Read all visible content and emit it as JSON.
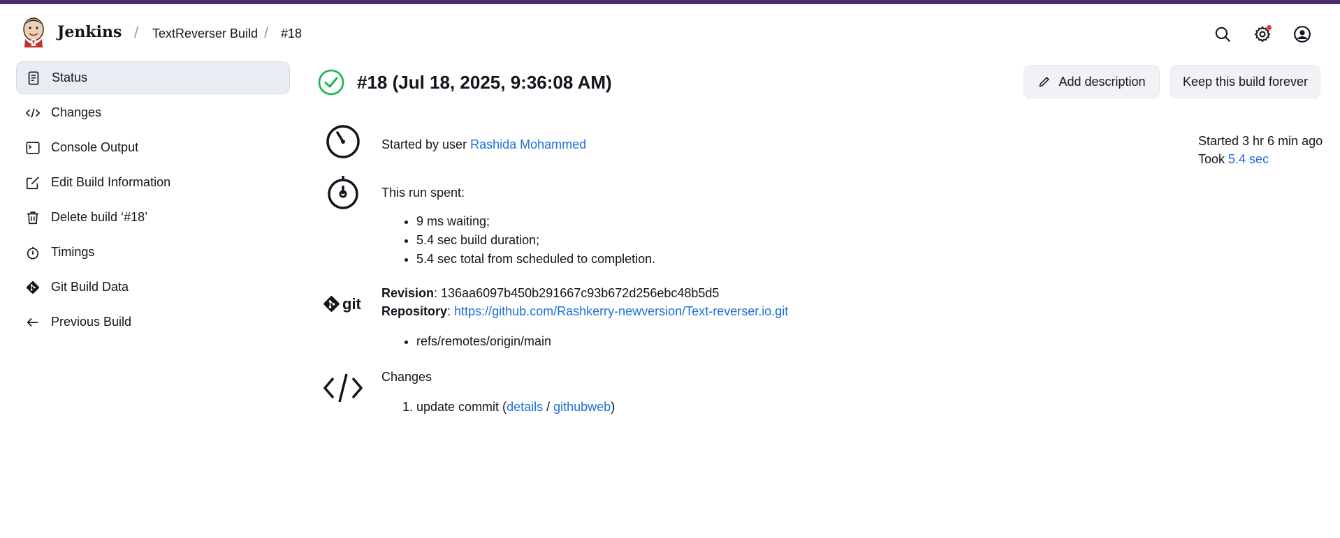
{
  "header": {
    "brand": "Jenkins",
    "breadcrumbs": [
      "TextReverser Build",
      "#18"
    ]
  },
  "sidebar": {
    "items": [
      {
        "label": "Status",
        "icon": "document-icon",
        "active": true
      },
      {
        "label": "Changes",
        "icon": "code-icon"
      },
      {
        "label": "Console Output",
        "icon": "terminal-icon"
      },
      {
        "label": "Edit Build Information",
        "icon": "edit-icon"
      },
      {
        "label": "Delete build ‘#18’",
        "icon": "trash-icon"
      },
      {
        "label": "Timings",
        "icon": "stopwatch-icon"
      },
      {
        "label": "Git Build Data",
        "icon": "git-icon"
      },
      {
        "label": "Previous Build",
        "icon": "arrow-left-icon"
      }
    ]
  },
  "build": {
    "title": "#18 (Jul 18, 2025, 9:36:08 AM)",
    "status": "success",
    "add_description": "Add description",
    "keep_forever": "Keep this build forever",
    "started_by_prefix": "Started by user ",
    "started_by_user": "Rashida Mohammed",
    "started_ago": "Started 3 hr 6 min ago",
    "took_prefix": "Took ",
    "took_value": "5.4 sec",
    "run_spent_label": "This run spent:",
    "run_spent": [
      "9 ms waiting;",
      "5.4 sec build duration;",
      "5.4 sec total from scheduled to completion."
    ],
    "revision_label": "Revision",
    "revision_value": ": 136aa6097b450b291667c93b672d256ebc48b5d5",
    "repository_label": "Repository",
    "repository_sep": ": ",
    "repository_url": "https://github.com/Rashkerry-newversion/Text-reverser.io.git",
    "refs": [
      "refs/remotes/origin/main"
    ],
    "changes_label": "Changes",
    "change_text": "update commit (",
    "change_details": "details",
    "change_slash": " / ",
    "change_githubweb": "githubweb",
    "change_close": ")"
  },
  "colors": {
    "accent_link": "#1a6fd9",
    "success": "#1db954",
    "topbar": "#4b2f6b"
  }
}
